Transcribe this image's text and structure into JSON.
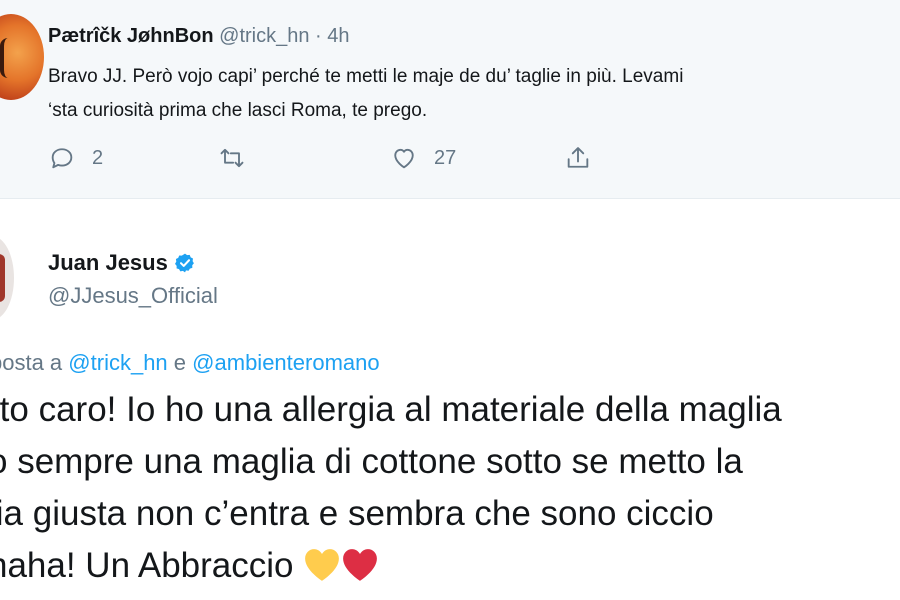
{
  "reply_tweet": {
    "display_name": "Pætrîčk JøhnBon",
    "handle": "@trick_hn",
    "separator": "·",
    "time": "4h",
    "text_lines": [
      "Bravo JJ. Però vojo capi’ perché te metti le maje de du’ taglie in più. Levami",
      "‘sta curiosità prima che lasci Roma, te prego."
    ],
    "actions": {
      "reply_count": "2",
      "retweet_count": "",
      "like_count": "27"
    }
  },
  "main_tweet": {
    "display_name": "Juan Jesus",
    "handle": "@JJesus_Official",
    "reply_prefix": "posta a",
    "reply_mention_1": "@trick_hn",
    "reply_joiner": "e",
    "reply_mention_2": "@ambienteromano",
    "text_lines": [
      "rto caro! Io ho una allergia al materiale della maglia",
      "o sempre una maglia di cottone sotto se metto la",
      "lia giusta non c’entra e sembra che sono ciccio",
      "haha! Un Abbraccio"
    ],
    "emoji": [
      "yellow-heart",
      "red-heart"
    ]
  },
  "colors": {
    "link": "#1da1f2",
    "secondary_text": "#657786",
    "reply_background": "#f5f8fa",
    "verified": "#1da1f2",
    "yellow_heart": "#ffcc4d",
    "red_heart": "#dd2e44"
  }
}
